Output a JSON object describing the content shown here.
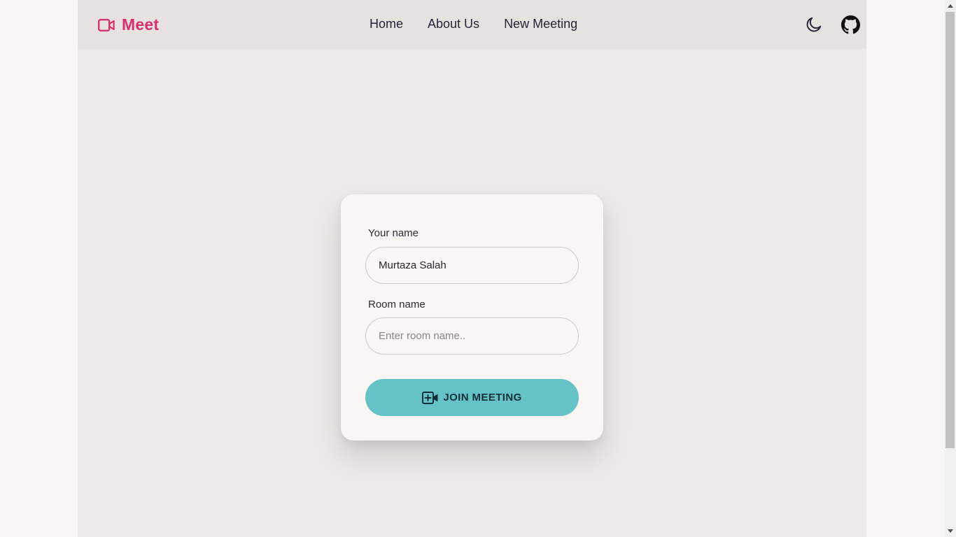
{
  "navbar": {
    "brand": "Meet",
    "links": [
      "Home",
      "About Us",
      "New Meeting"
    ],
    "icons": {
      "brand": "video-camera-icon",
      "theme": "moon-icon",
      "github": "github-icon"
    }
  },
  "form": {
    "name_label": "Your name",
    "name_value": "Murtaza Salah",
    "room_label": "Room name",
    "room_placeholder": "Enter room name..",
    "room_value": "",
    "join_label": "JOIN MEETING",
    "join_icon": "video-plus-icon"
  },
  "colors": {
    "brand": "#d6306e",
    "accent_button": "#65c3c7",
    "navbar_bg": "#e7e2e0",
    "page_bg": "#eee9e6",
    "card_bg": "#f9f6f4"
  }
}
